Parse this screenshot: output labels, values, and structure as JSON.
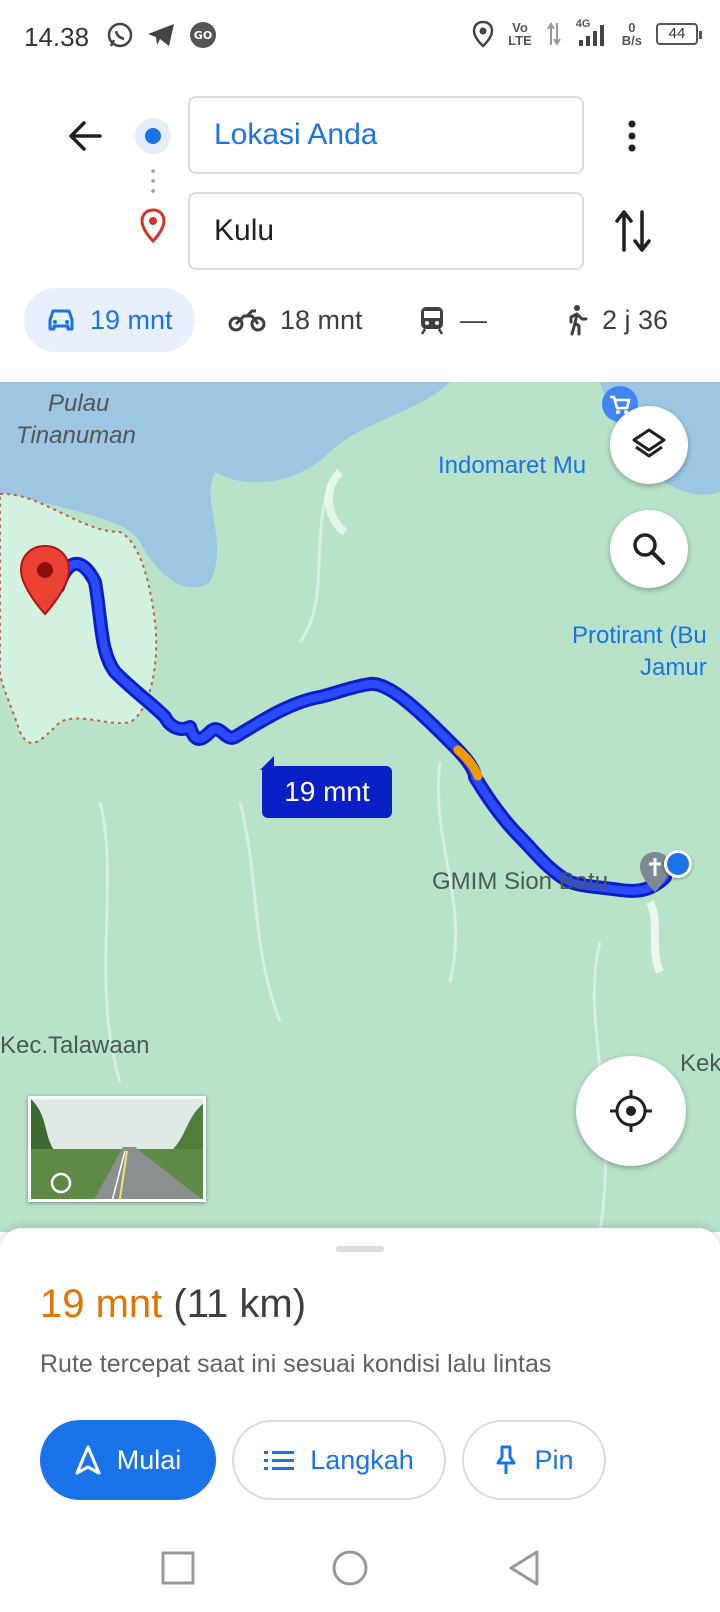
{
  "status_bar": {
    "time": "14.38",
    "network_speed_top": "0",
    "network_speed_bottom": "B/s",
    "volte_top": "Vo",
    "volte_bottom": "LTE",
    "signal_label": "4G",
    "battery": "44"
  },
  "directions": {
    "origin_value": "Lokasi Anda",
    "destination_value": "Kulu"
  },
  "modes": [
    {
      "icon": "car-icon",
      "label": "19 mnt",
      "active": true
    },
    {
      "icon": "motorcycle-icon",
      "label": "18 mnt",
      "active": false
    },
    {
      "icon": "transit-icon",
      "label": "—",
      "active": false
    },
    {
      "icon": "walk-icon",
      "label": "2 j 36",
      "active": false
    }
  ],
  "map": {
    "labels": {
      "pulau_line1": "Pulau",
      "pulau_line2": "Tinanuman",
      "indomaret": "Indomaret Mu",
      "protirant_line1": "Protirant (Bu",
      "protirant_line2": "Jamur",
      "gmim": "GMIM Sion Batu",
      "talawaan": "Kec.Talawaan",
      "kek": "Kek"
    },
    "route_time": "19 mnt"
  },
  "sheet": {
    "duration": "19 mnt",
    "distance": "(11 km)",
    "description": "Rute tercepat saat ini sesuai kondisi lalu lintas",
    "start_label": "Mulai",
    "steps_label": "Langkah",
    "pin_label": "Pin"
  },
  "colors": {
    "accent": "#1a73e8",
    "route": "#0b1fc7",
    "duration": "#e37400",
    "map_land": "#b9e3c9",
    "map_water": "#9cc6e2"
  }
}
